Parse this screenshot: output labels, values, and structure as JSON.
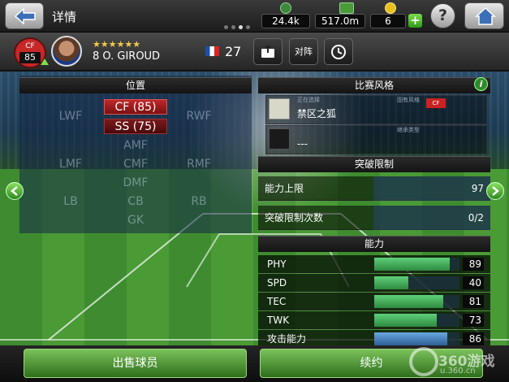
{
  "header": {
    "title": "详情",
    "gp": "24.4k",
    "money": "517.0m",
    "coins": "6"
  },
  "player": {
    "position": "CF",
    "rating": "85",
    "name": "8 O. GIROUD",
    "stars": "★★★★★★",
    "age": "27",
    "btn_formation": "对阵"
  },
  "positions": {
    "title": "位置",
    "main": "CF (85)",
    "sub": "SS (75)",
    "others": [
      "LWF",
      "RWF",
      "AMF",
      "LMF",
      "CMF",
      "RMF",
      "DMF",
      "LB",
      "CB",
      "RB",
      "GK"
    ]
  },
  "play_style": {
    "title": "比赛风格",
    "selected_label": "正在选择",
    "style_name": "禁区之狐",
    "inherent_label": "固有风格",
    "inherent_badge": "CF",
    "inherit_label": "继承类型",
    "inherit_value": "---"
  },
  "breakthrough": {
    "title": "突破限制",
    "rows": [
      {
        "label": "能力上限",
        "value": "97"
      },
      {
        "label": "突破限制次数",
        "value": "0/2"
      }
    ]
  },
  "ability": {
    "title": "能力",
    "stats": [
      {
        "label": "PHY",
        "value": "89",
        "level": 0.89
      },
      {
        "label": "SPD",
        "value": "40",
        "level": 0.4
      },
      {
        "label": "TEC",
        "value": "81",
        "level": 0.81
      },
      {
        "label": "TWK",
        "value": "73",
        "level": 0.73
      },
      {
        "label": "攻击能力",
        "value": "86",
        "level": 0.86
      }
    ]
  },
  "actions": {
    "sell": "出售球员",
    "renew": "续约"
  },
  "watermark": {
    "text": "360游戏",
    "url": "u.360.cn"
  },
  "colors": {
    "accent_green": "#2e8a3f",
    "position_red": "#c0282a"
  }
}
